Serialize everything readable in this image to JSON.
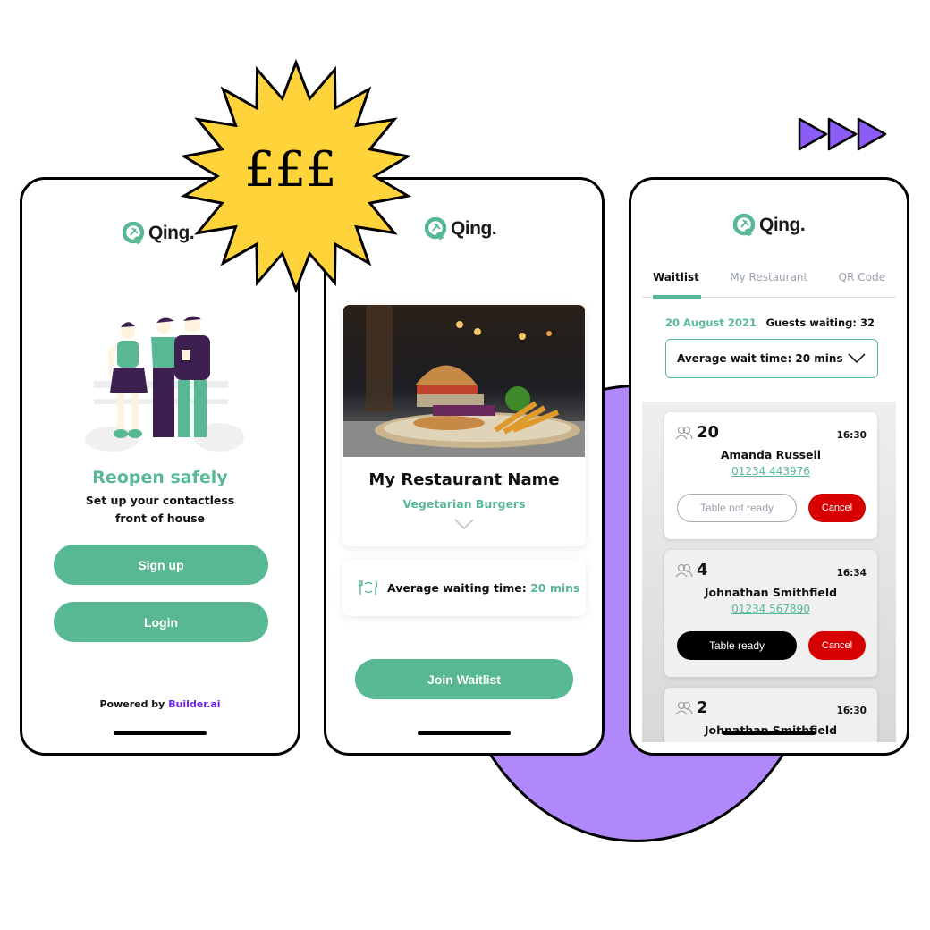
{
  "colors": {
    "brand_green": "#58b893",
    "cancel_red": "#d70000",
    "accent_purple": "#b088fb",
    "badge_yellow": "#ffd43b",
    "builder_purple": "#6c1ff0"
  },
  "badge": {
    "text": "£££",
    "icon": "starburst-badge"
  },
  "decor": {
    "arrows_icon": "triple-play-arrows"
  },
  "phone1": {
    "logo_text": "Qing.",
    "illustration": "people-chatting-illustration",
    "title": "Reopen safely",
    "subtitle_line1": "Set up your contactless",
    "subtitle_line2": "front of house",
    "signup_label": "Sign up",
    "login_label": "Login",
    "powered_prefix": "Powered by",
    "powered_brand": "Builder.ai"
  },
  "phone2": {
    "logo_text": "Qing.",
    "restaurant_name": "My Restaurant Name",
    "restaurant_type": "Vegetarian Burgers",
    "photo": "burger-and-fries-photo",
    "wait_label": "Average waiting time:",
    "wait_value": "20 mins",
    "join_label": "Join Waitlist"
  },
  "phone3": {
    "logo_text": "Qing.",
    "tabs": [
      {
        "label": "Waitlist",
        "active": true
      },
      {
        "label": "My Restaurant",
        "active": false
      },
      {
        "label": "QR Code",
        "active": false
      }
    ],
    "date": "20 August 2021",
    "guests_waiting": "Guests waiting: 32",
    "avg_wait_select": "Average wait time: 20 mins",
    "queue": [
      {
        "party": "20",
        "time": "16:30",
        "name": "Amanda Russell",
        "phone": "01234 443976",
        "primary_label": "Table not ready",
        "primary_style": "outline",
        "cancel_label": "Cancel"
      },
      {
        "party": "4",
        "time": "16:34",
        "name": "Johnathan Smithfield",
        "phone": "01234 567890",
        "primary_label": "Table ready",
        "primary_style": "solid",
        "cancel_label": "Cancel"
      },
      {
        "party": "2",
        "time": "16:30",
        "name": "Johnathan Smithfield",
        "phone": "",
        "primary_label": "",
        "primary_style": "",
        "cancel_label": ""
      }
    ]
  }
}
